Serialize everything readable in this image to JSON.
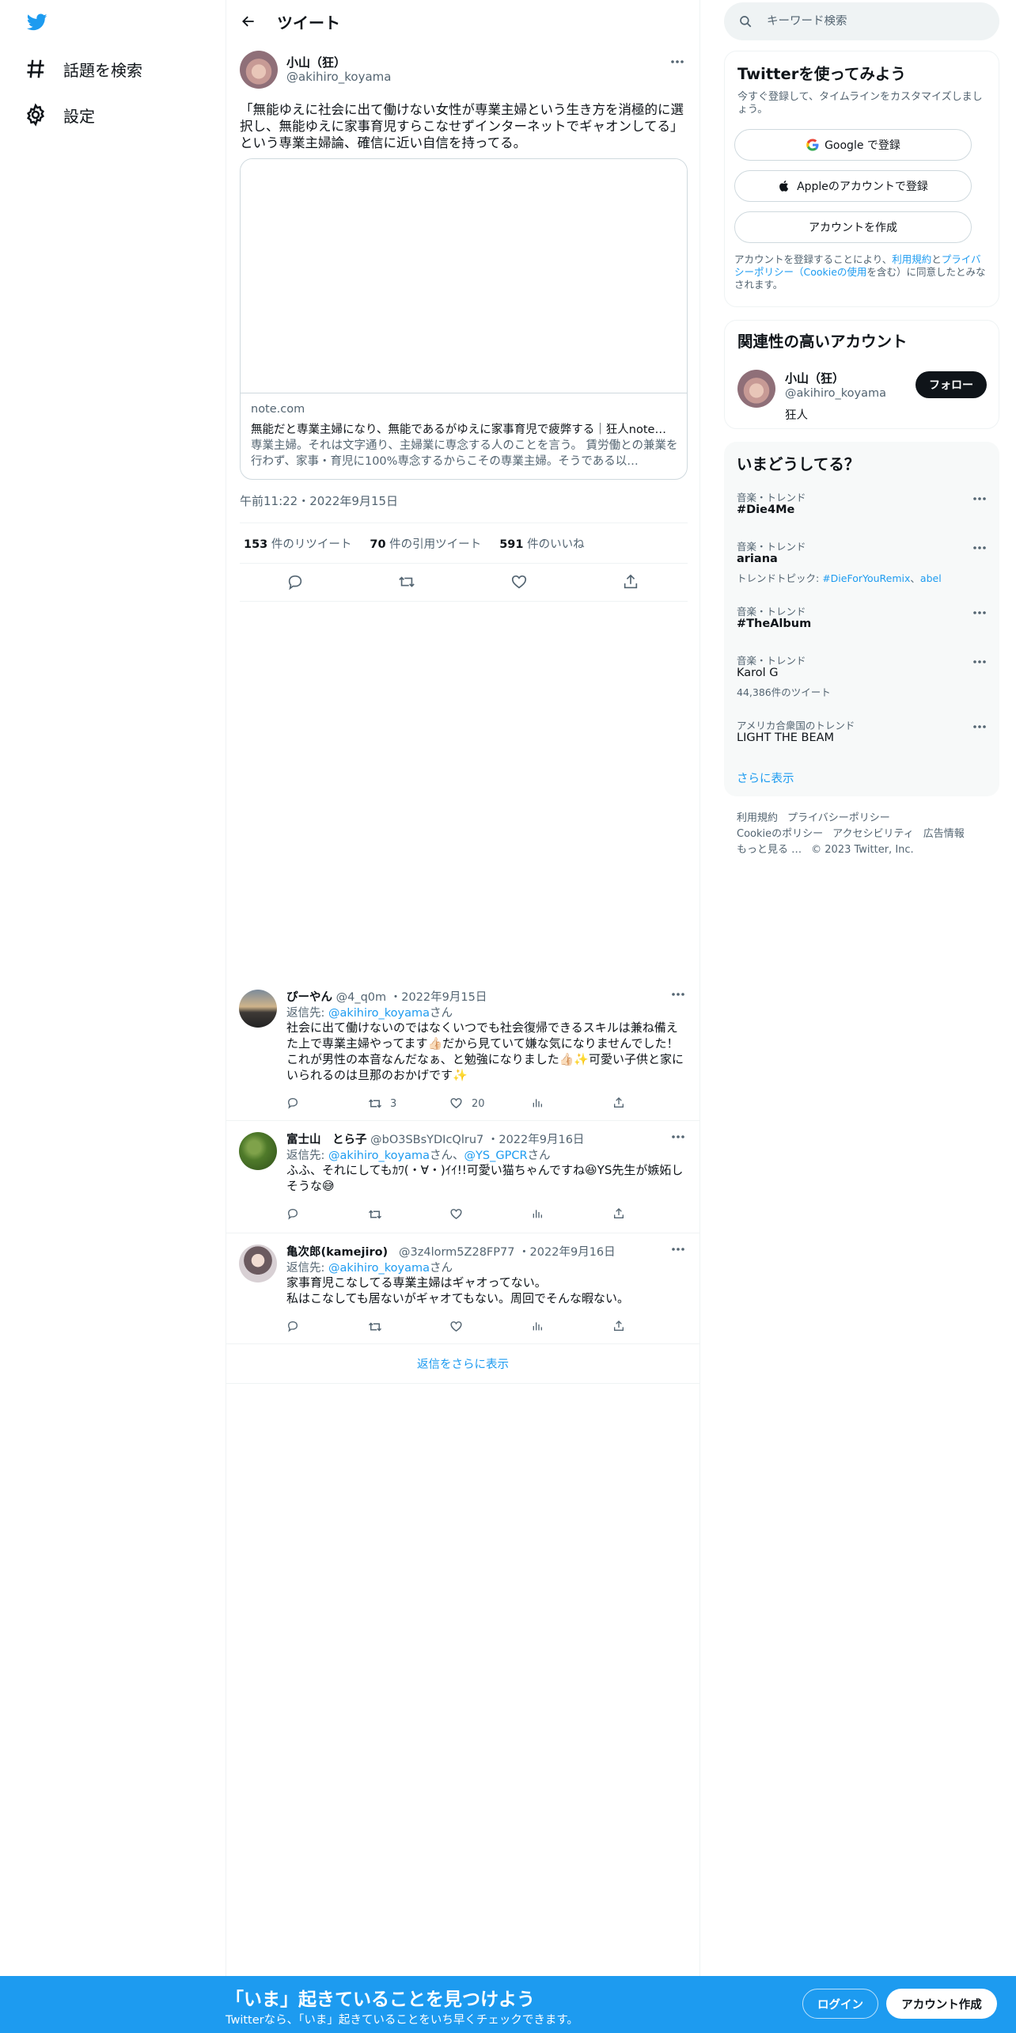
{
  "nav": {
    "logo_icon": "twitter-bird-icon",
    "items": [
      {
        "label": "話題を検索",
        "icon": "hashtag-icon"
      },
      {
        "label": "設定",
        "icon": "gear-icon"
      }
    ]
  },
  "header": {
    "title": "ツイート"
  },
  "tweet": {
    "name": "小山（狂）",
    "handle": "@akihiro_koyama",
    "text": "「無能ゆえに社会に出て働けない女性が専業主婦という生き方を消極的に選択し、無能ゆえに家事育児すらこなせずインターネットでギャオンしてる」という専業主婦論、確信に近い自信を持ってる。",
    "card": {
      "domain": "note.com",
      "title": "無能だと専業主婦になり、無能であるがゆえに家事育児で疲弊する｜狂人note…",
      "description": "専業主婦。それは文字通り、主婦業に専念する人のことを言う。 賃労働との兼業を行わず、家事・育児に100%専念するからこその専業主婦。そうである以…"
    },
    "timestamp": "午前11:22・2022年9月15日",
    "stats": {
      "retweets": "153",
      "retweets_label": " 件のリツイート",
      "quotes": "70",
      "quotes_label": " 件の引用ツイート",
      "likes": "591",
      "likes_label": " 件のいいね"
    }
  },
  "replies": [
    {
      "name": "ぴーやん",
      "handle": "@4_q0m",
      "date": "・2022年9月15日",
      "replying_prefix": "返信先: ",
      "replying_to": [
        "@akihiro_koyama"
      ],
      "replying_sep": "",
      "replying_suffix": "さん",
      "text": "社会に出て働けないのではなくいつでも社会復帰できるスキルは兼ね備えた上で専業主婦やってます👍🏻だから見ていて嫌な気になりませんでした！これが男性の本音なんだなぁ、と勉強になりました👍🏻✨可愛い子供と家にいられるのは旦那のおかげです✨",
      "retweets": "3",
      "likes": "20"
    },
    {
      "name": "富士山　とら子",
      "handle": "@bO3SBsYDIcQlru7",
      "date": "・2022年9月16日",
      "replying_prefix": "返信先: ",
      "replying_to": [
        "@akihiro_koyama",
        "@YS_GPCR"
      ],
      "replying_sep": "さん、",
      "replying_suffix": "さん",
      "text": "ふふ、それにしてもｶﾜ(・∀・)ｲｲ!!可愛い猫ちゃんですね😆YS先生が嫉妬しそうな😅",
      "retweets": "",
      "likes": ""
    },
    {
      "name": "亀次郎(kamejiro)",
      "handle": "@3z4lorm5Z28FP77",
      "date": "・2022年9月16日",
      "replying_prefix": "返信先: ",
      "replying_to": [
        "@akihiro_koyama"
      ],
      "replying_sep": "",
      "replying_suffix": "さん",
      "text": "家事育児こなしてる専業主婦はギャオってない。\n私はこなしても居ないがギャオてもない。周回でそんな暇ない。",
      "retweets": "",
      "likes": ""
    }
  ],
  "show_more_replies": "返信をさらに表示",
  "search": {
    "placeholder": "キーワード検索"
  },
  "signup": {
    "title": "Twitterを使ってみよう",
    "subtitle": "今すぐ登録して、タイムラインをカスタマイズしましょう。",
    "google": "Google で登録",
    "apple": "Appleのアカウントで登録",
    "create": "アカウントを作成",
    "terms_1": "アカウントを登録することにより、",
    "terms_link_1": "利用規約",
    "terms_2": "と",
    "terms_link_2": "プライバシーポリシー（Cookieの使用",
    "terms_3": "を含む）に同意したとみなされます。"
  },
  "relevant": {
    "title": "関連性の高いアカウント",
    "name": "小山（狂）",
    "handle": "@akihiro_koyama",
    "bio": "狂人",
    "follow": "フォロー"
  },
  "trends": {
    "title": "いまどうしてる？",
    "items": [
      {
        "context": "音楽・トレンド",
        "name": "#Die4Me",
        "meta_prefix": "",
        "meta_links": []
      },
      {
        "context": "音楽・トレンド",
        "name": "ariana",
        "meta_prefix": "トレンドトピック: ",
        "meta_links": [
          "#DieForYouRemix",
          "abel"
        ]
      },
      {
        "context": "音楽・トレンド",
        "name": "#TheAlbum",
        "meta_prefix": "",
        "meta_links": []
      },
      {
        "context": "音楽・トレンド",
        "name": "Karol G",
        "meta_prefix": "44,386件のツイート",
        "meta_links": []
      },
      {
        "context": "アメリカ合衆国のトレンド",
        "name": "LIGHT THE BEAM",
        "meta_prefix": "",
        "meta_links": []
      }
    ],
    "show_more": "さらに表示"
  },
  "footer": {
    "links": [
      "利用規約",
      "プライバシーポリシー",
      "Cookieのポリシー",
      "アクセシビリティ",
      "広告情報",
      "もっと見る …"
    ],
    "copyright": "© 2023 Twitter, Inc."
  },
  "bottom_bar": {
    "title": "「いま」起きていることを見つけよう",
    "subtitle": "Twitterなら、「いま」起きていることをいち早くチェックできます。",
    "login": "ログイン",
    "signup": "アカウント作成"
  },
  "colors": {
    "accent": "#1d9bf0",
    "text": "#0f1419",
    "muted": "#536471",
    "border": "#eff3f4"
  }
}
